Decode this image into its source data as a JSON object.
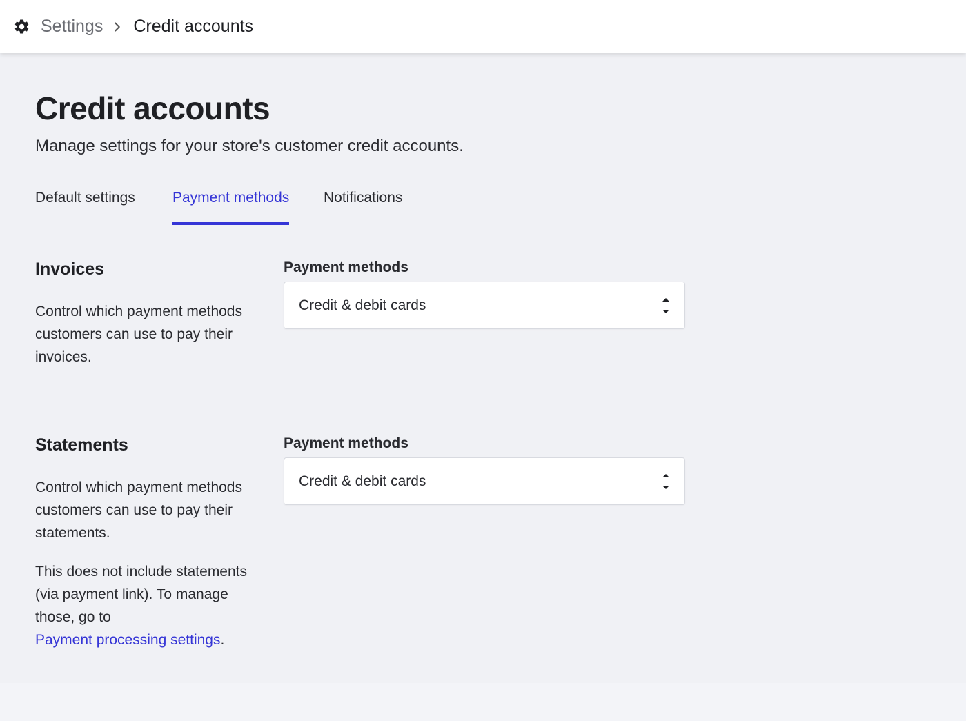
{
  "breadcrumb": {
    "icon": "gear-icon",
    "parent": "Settings",
    "current": "Credit accounts"
  },
  "page": {
    "title": "Credit accounts",
    "subtitle": "Manage settings for your store's customer credit accounts."
  },
  "tabs": [
    {
      "label": "Default settings",
      "active": false
    },
    {
      "label": "Payment methods",
      "active": true
    },
    {
      "label": "Notifications",
      "active": false
    }
  ],
  "sections": {
    "invoices": {
      "title": "Invoices",
      "description": "Control which payment methods customers can use to pay their invoices.",
      "field_label": "Payment methods",
      "selected_value": "Credit & debit cards"
    },
    "statements": {
      "title": "Statements",
      "description": "Control which payment methods customers can use to pay their statements.",
      "note_text": "This does not include statements (via payment link). To manage those, go to",
      "note_link": "Payment processing settings",
      "note_end": ".",
      "field_label": "Payment methods",
      "selected_value": "Credit & debit cards"
    }
  },
  "colors": {
    "accent": "#3535d6",
    "background": "#f0f1f5",
    "text": "#1f2024"
  }
}
